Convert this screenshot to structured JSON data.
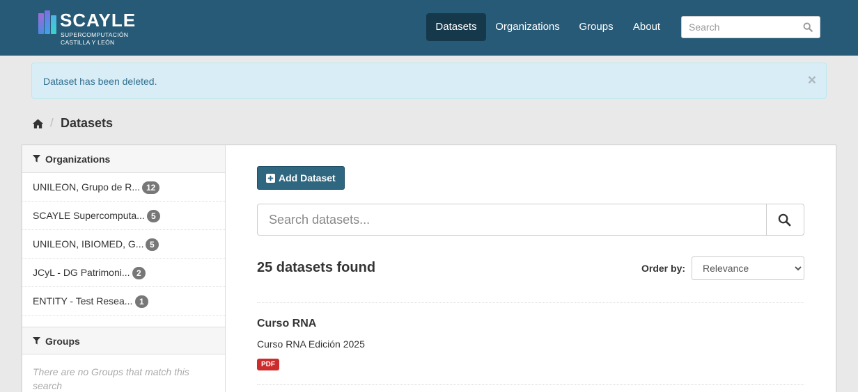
{
  "brand": {
    "name": "SCAYLE",
    "subtitle_line1": "SUPERCOMPUTACIÓN",
    "subtitle_line2": "CASTILLA Y LEÓN"
  },
  "nav": {
    "items": [
      {
        "label": "Datasets",
        "active": true
      },
      {
        "label": "Organizations",
        "active": false
      },
      {
        "label": "Groups",
        "active": false
      },
      {
        "label": "About",
        "active": false
      }
    ]
  },
  "header_search": {
    "placeholder": "Search",
    "icon": "search-icon"
  },
  "alert": {
    "message": "Dataset has been deleted.",
    "close": "×"
  },
  "breadcrumb": {
    "home_icon": "home-icon",
    "separator": "/",
    "current": "Datasets"
  },
  "sidebar": {
    "organizations": {
      "heading": "Organizations",
      "icon": "filter-icon",
      "items": [
        {
          "label": "UNILEON, Grupo de R...",
          "count": "12"
        },
        {
          "label": "SCAYLE Supercomputa...",
          "count": "5"
        },
        {
          "label": "UNILEON, IBIOMED, G...",
          "count": "5"
        },
        {
          "label": "JCyL - DG Patrimoni...",
          "count": "2"
        },
        {
          "label": "ENTITY - Test Resea...",
          "count": "1"
        }
      ]
    },
    "groups": {
      "heading": "Groups",
      "icon": "filter-icon",
      "empty_message": "There are no Groups that match this search"
    }
  },
  "main": {
    "add_button": {
      "label": "Add Dataset",
      "icon": "plus-square-icon"
    },
    "search": {
      "placeholder": "Search datasets...",
      "icon": "search-icon"
    },
    "results_count": "25 datasets found",
    "order_by": {
      "label": "Order by:",
      "selected": "Relevance"
    },
    "datasets": [
      {
        "title": "Curso RNA",
        "notes": "Curso RNA Edición 2025",
        "formats": [
          "PDF"
        ]
      }
    ]
  },
  "colors": {
    "masthead": "#275a76",
    "nav_active": "#16384b",
    "alert_bg": "#d9edf7",
    "alert_text": "#31708f",
    "primary_button": "#2f6781",
    "badge_count": "#777777",
    "format_pdf": "#cc2c2c"
  }
}
